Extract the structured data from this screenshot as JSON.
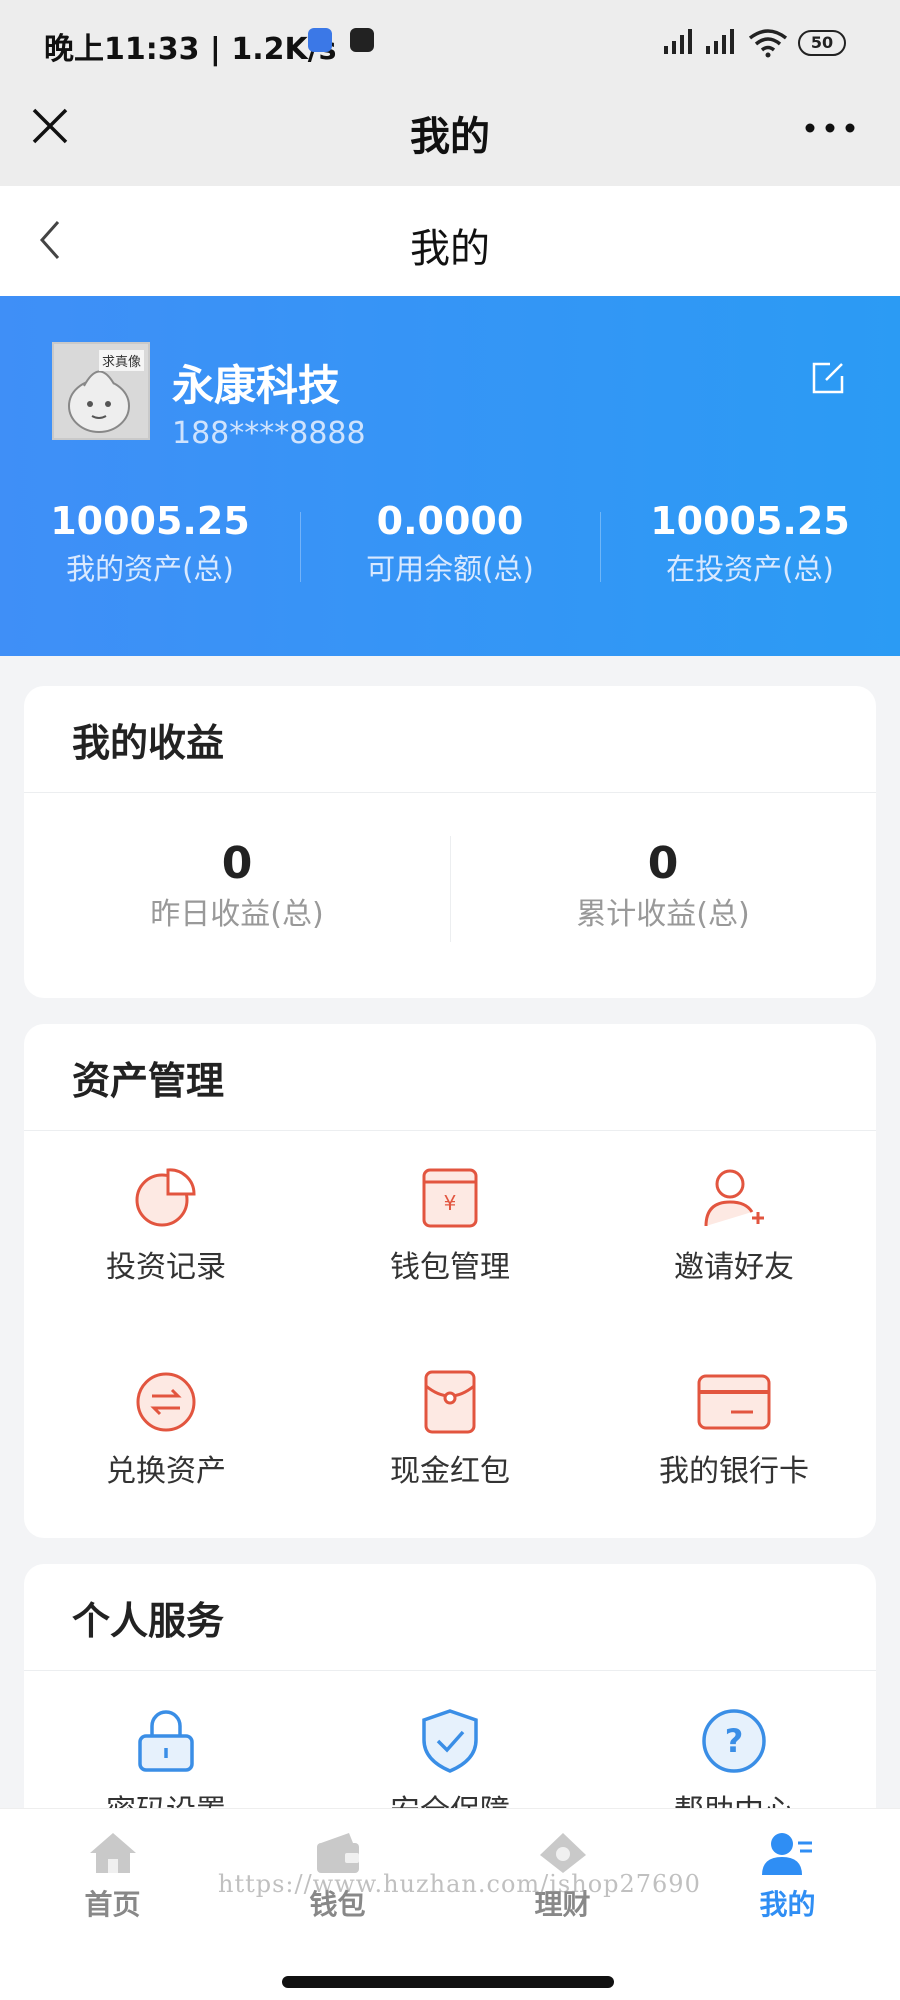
{
  "status_bar": {
    "time_text": "晚上11:33 | 1.2K/s",
    "battery": "50"
  },
  "wechat_bar": {
    "title": "我的"
  },
  "page_header": {
    "title": "我的"
  },
  "profile": {
    "avatar_tag": "求真像",
    "name": "永康科技",
    "phone": "188****8888",
    "stats": [
      {
        "value": "10005.25",
        "label": "我的资产(总)"
      },
      {
        "value": "0.0000",
        "label": "可用余额(总)"
      },
      {
        "value": "10005.25",
        "label": "在投资产(总)"
      }
    ]
  },
  "earnings": {
    "title": "我的收益",
    "items": [
      {
        "value": "0",
        "label": "昨日收益(总)"
      },
      {
        "value": "0",
        "label": "累计收益(总)"
      }
    ]
  },
  "assets": {
    "title": "资产管理",
    "items": [
      {
        "label": "投资记录",
        "icon": "pie-chart-icon"
      },
      {
        "label": "钱包管理",
        "icon": "wallet-yuan-icon"
      },
      {
        "label": "邀请好友",
        "icon": "add-user-icon"
      },
      {
        "label": "兑换资产",
        "icon": "exchange-icon"
      },
      {
        "label": "现金红包",
        "icon": "red-envelope-icon"
      },
      {
        "label": "我的银行卡",
        "icon": "bank-card-icon"
      }
    ]
  },
  "services": {
    "title": "个人服务",
    "items": [
      {
        "label": "密码设置",
        "icon": "lock-icon"
      },
      {
        "label": "安全保障",
        "icon": "shield-check-icon"
      },
      {
        "label": "帮助中心",
        "icon": "help-icon"
      }
    ]
  },
  "tabbar": {
    "items": [
      {
        "label": "首页",
        "icon": "home-icon"
      },
      {
        "label": "钱包",
        "icon": "wallet-icon"
      },
      {
        "label": "理财",
        "icon": "finance-icon"
      },
      {
        "label": "我的",
        "icon": "user-icon"
      }
    ],
    "active_index": 3
  },
  "watermark": "https://www.huzhan.com/ishop27690",
  "colors": {
    "brand_blue": "#3f8ff7",
    "accent_red": "#e2553f",
    "service_blue": "#3a8ee6",
    "tab_active": "#2f8ef4"
  }
}
